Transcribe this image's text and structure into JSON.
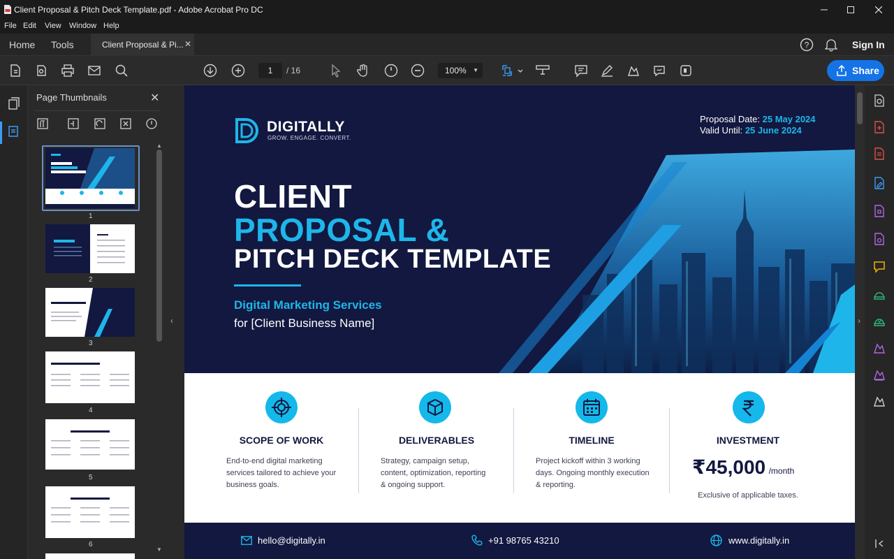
{
  "window": {
    "title": "Client Proposal & Pitch Deck Template.pdf - Adobe Acrobat Pro DC"
  },
  "menu": [
    "File",
    "Edit",
    "View",
    "Window",
    "Help"
  ],
  "tabs": {
    "home": "Home",
    "tools": "Tools",
    "document": "Client Proposal & Pi...",
    "sign_in": "Sign In"
  },
  "toolbar": {
    "current_page": "1",
    "page_total": "/ 16",
    "zoom": "100%",
    "share_label": "Share"
  },
  "thumbnails": {
    "header": "Page Thumbnails",
    "pages": [
      {
        "num": "1",
        "label": "CLIENT PROPOSAL & PITCH DECK TEMPLATE"
      },
      {
        "num": "2",
        "label": "AGENDA"
      },
      {
        "num": "3",
        "label": "ABOUT OUR AGENCY"
      },
      {
        "num": "4",
        "label": "PROJECT OVERVIEW"
      },
      {
        "num": "5",
        "label": "SCOPE OF WORK"
      },
      {
        "num": "6",
        "label": "DELIVERABLES"
      }
    ]
  },
  "page": {
    "brand": "DIGITALLY",
    "tagline": "GROW. ENGAGE. CONVERT.",
    "proposal_date_label": "Proposal Date:",
    "proposal_date": "25 May 2024",
    "valid_until_label": "Valid Until:",
    "valid_until": "25 June 2024",
    "title_line1": "CLIENT",
    "title_line2": "PROPOSAL &",
    "title_line3": "PITCH DECK TEMPLATE",
    "subtitle": "Digital Marketing Services",
    "client_line": "for [Client Business Name]",
    "cards": [
      {
        "title": "SCOPE OF WORK",
        "lines": [
          "End-to-end digital marketing",
          "services tailored to achieve your",
          "business goals."
        ],
        "icon": "target-icon"
      },
      {
        "title": "DELIVERABLES",
        "lines": [
          "Strategy, campaign setup,",
          "content, optimization, reporting",
          "& ongoing support."
        ],
        "icon": "box-icon"
      },
      {
        "title": "TIMELINE",
        "lines": [
          "Project kickoff within 3 working",
          "days. Ongoing monthly execution",
          "& reporting."
        ],
        "icon": "calendar-icon"
      },
      {
        "title": "INVESTMENT",
        "amount": "₹45,000",
        "per": "/month",
        "note": "Exclusive of applicable taxes.",
        "icon": "rupee-icon"
      }
    ],
    "footer": {
      "email": "hello@digitally.in",
      "phone": "+91 98765 43210",
      "website": "www.digitally.in"
    }
  },
  "colors": {
    "accent": "#1473e6",
    "page_navy": "#12183f",
    "brand_cyan": "#1eb6ea"
  }
}
